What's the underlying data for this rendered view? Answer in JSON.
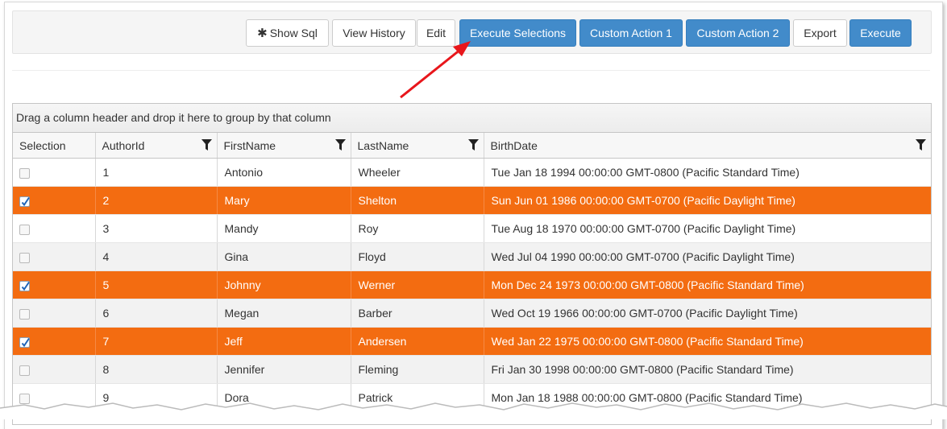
{
  "toolbar": {
    "buttons": [
      {
        "label": "Show Sql",
        "icon": "asterisk-icon",
        "style": "default"
      },
      {
        "label": "View History",
        "style": "default"
      },
      {
        "label": "Edit",
        "style": "default"
      },
      {
        "label": "Execute Selections",
        "style": "primary"
      },
      {
        "label": "Custom Action 1",
        "style": "primary"
      },
      {
        "label": "Custom Action 2",
        "style": "primary"
      },
      {
        "label": "Export",
        "style": "default"
      },
      {
        "label": "Execute",
        "style": "primary"
      }
    ]
  },
  "grid": {
    "group_panel_text": "Drag a column header and drop it here to group by that column",
    "columns": [
      "Selection",
      "AuthorId",
      "FirstName",
      "LastName",
      "BirthDate"
    ],
    "rows": [
      {
        "selected": false,
        "author_id": "1",
        "first_name": "Antonio",
        "last_name": "Wheeler",
        "birth_date": "Tue Jan 18 1994 00:00:00 GMT-0800 (Pacific Standard Time)"
      },
      {
        "selected": true,
        "author_id": "2",
        "first_name": "Mary",
        "last_name": "Shelton",
        "birth_date": "Sun Jun 01 1986 00:00:00 GMT-0700 (Pacific Daylight Time)"
      },
      {
        "selected": false,
        "author_id": "3",
        "first_name": "Mandy",
        "last_name": "Roy",
        "birth_date": "Tue Aug 18 1970 00:00:00 GMT-0700 (Pacific Daylight Time)"
      },
      {
        "selected": false,
        "author_id": "4",
        "first_name": "Gina",
        "last_name": "Floyd",
        "birth_date": "Wed Jul 04 1990 00:00:00 GMT-0700 (Pacific Daylight Time)"
      },
      {
        "selected": true,
        "author_id": "5",
        "first_name": "Johnny",
        "last_name": "Werner",
        "birth_date": "Mon Dec 24 1973 00:00:00 GMT-0800 (Pacific Standard Time)"
      },
      {
        "selected": false,
        "author_id": "6",
        "first_name": "Megan",
        "last_name": "Barber",
        "birth_date": "Wed Oct 19 1966 00:00:00 GMT-0700 (Pacific Daylight Time)"
      },
      {
        "selected": true,
        "author_id": "7",
        "first_name": "Jeff",
        "last_name": "Andersen",
        "birth_date": "Wed Jan 22 1975 00:00:00 GMT-0800 (Pacific Standard Time)"
      },
      {
        "selected": false,
        "author_id": "8",
        "first_name": "Jennifer",
        "last_name": "Fleming",
        "birth_date": "Fri Jan 30 1998 00:00:00 GMT-0800 (Pacific Standard Time)"
      },
      {
        "selected": false,
        "author_id": "9",
        "first_name": "Dora",
        "last_name": "Patrick",
        "birth_date": "Mon Jan 18 1988 00:00:00 GMT-0800 (Pacific Standard Time)"
      }
    ]
  },
  "colors": {
    "primary_button": "#428bca",
    "selected_row": "#f36c11",
    "annotation_arrow": "#e8161b"
  }
}
